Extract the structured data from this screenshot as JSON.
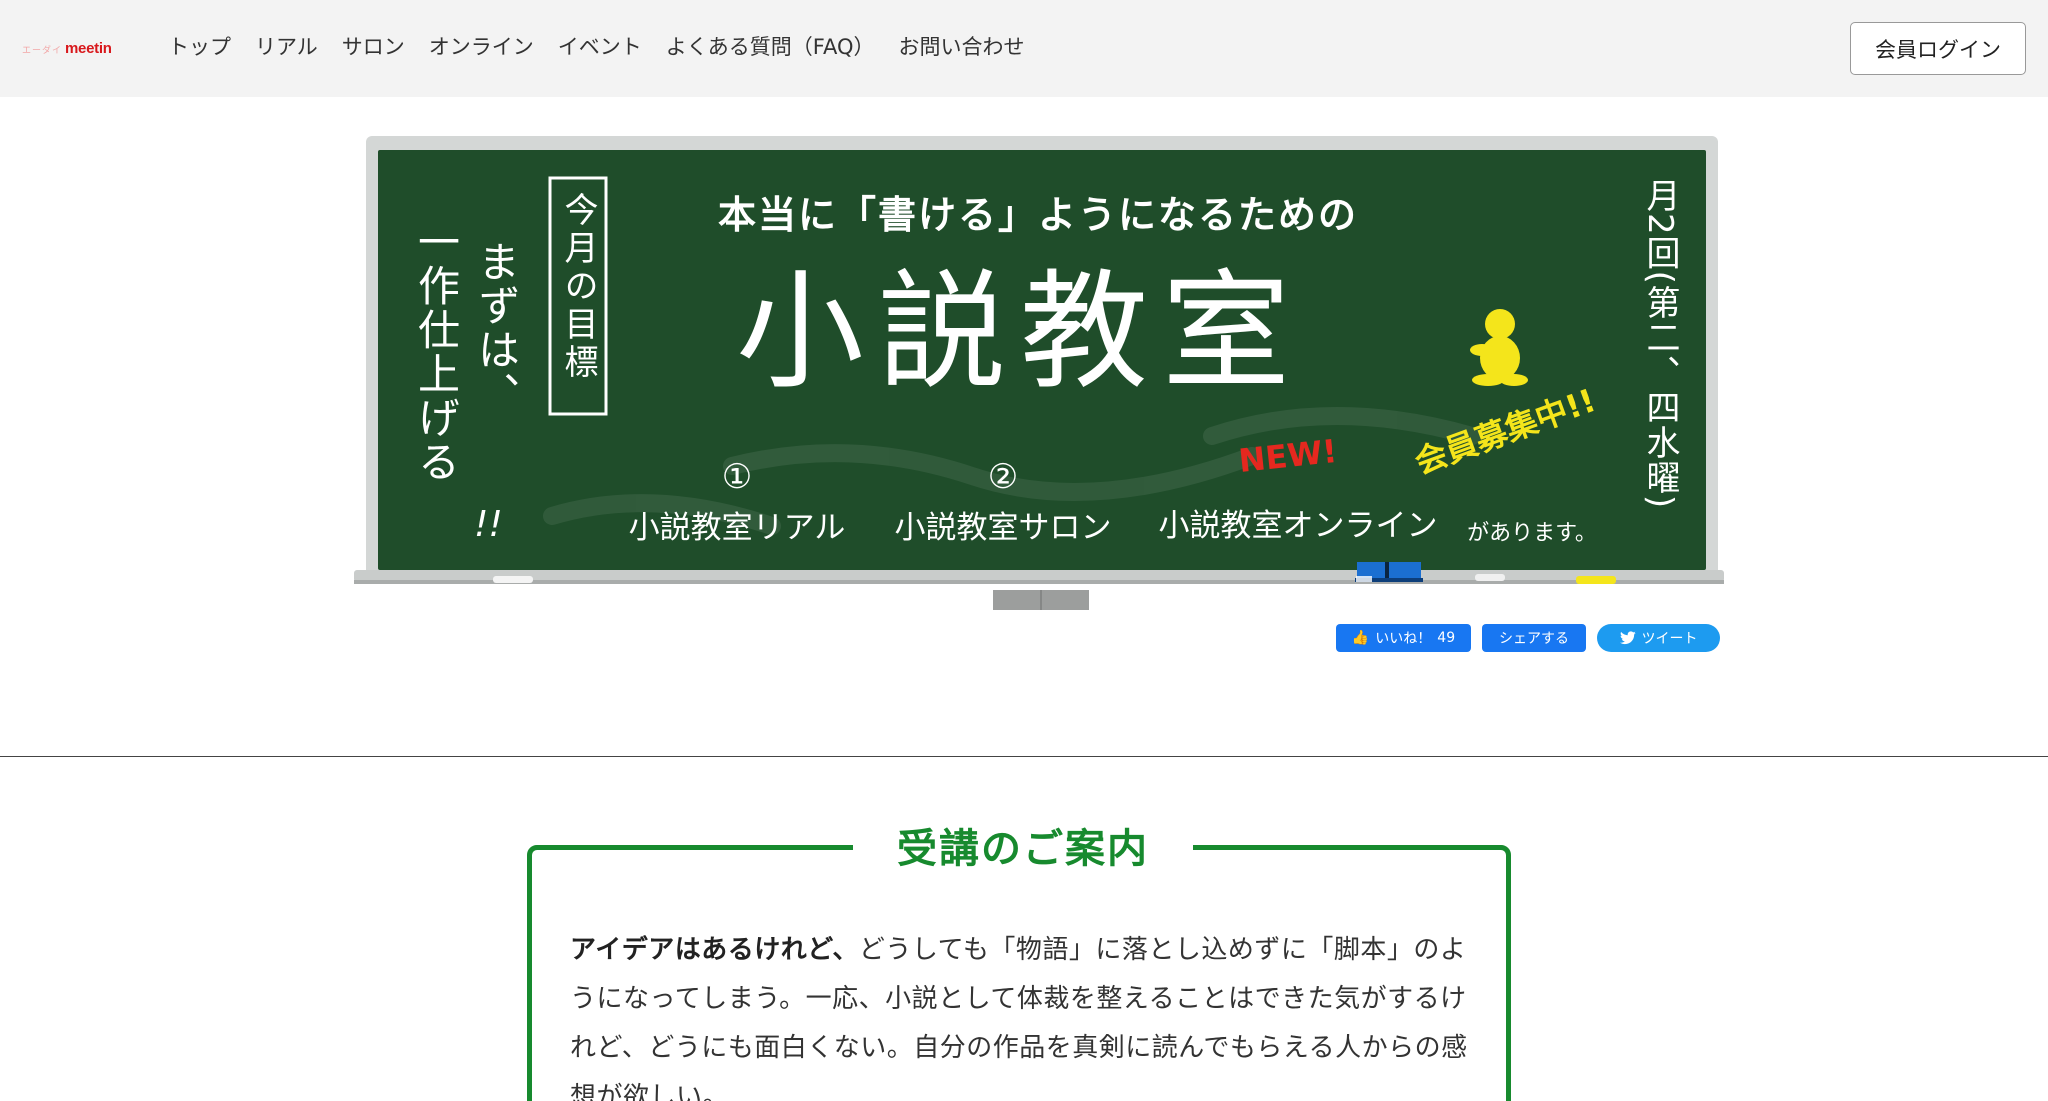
{
  "header": {
    "logo_small": "エーダイ",
    "logo_main": "meetin",
    "nav": [
      "トップ",
      "リアル",
      "サロン",
      "オンライン",
      "イベント",
      "よくある質問（FAQ）",
      "お問い合わせ"
    ],
    "login_label": "会員ログイン"
  },
  "banner": {
    "left_vertical_1": "まずは、",
    "left_vertical_2": "一作仕上げる",
    "left_exclaim": "!!",
    "goal_label": "今月の目標",
    "subtitle": "本当に「書ける」ようになるための",
    "title": "小説教室",
    "recruit": "会員募集中!!",
    "new_badge": "NEW!",
    "course_1_num": "①",
    "course_1": "小説教室リアル",
    "course_2_num": "②",
    "course_2": "小説教室サロン",
    "course_3": "小説教室オンライン",
    "suffix": "があります。",
    "schedule": "月2回(第二、四水曜)"
  },
  "share": {
    "like_label": "いいね！",
    "like_count": "49",
    "fb_share_label": "シェアする",
    "tweet_label": "ツイート"
  },
  "info": {
    "title": "受講のご案内",
    "lead_bold": "アイデアはあるけれど、",
    "body": "どうしても「物語」に落とし込めずに「脚本」のようになってしまう。一応、小説として体裁を整えることはできた気がするけれど、どうにも面白くない。自分の作品を真剣に読んでもらえる人からの感想が欲しい。"
  },
  "colors": {
    "header_bg": "#f3f3f3",
    "board": "#1f4d2a",
    "frame": "#cfd3d2",
    "accent_green": "#178a2e",
    "fb_blue": "#1877f2",
    "tw_blue": "#1d9bf0",
    "logo_red": "#d8181c",
    "yellow": "#f4e51b",
    "new_red": "#e5281f"
  }
}
